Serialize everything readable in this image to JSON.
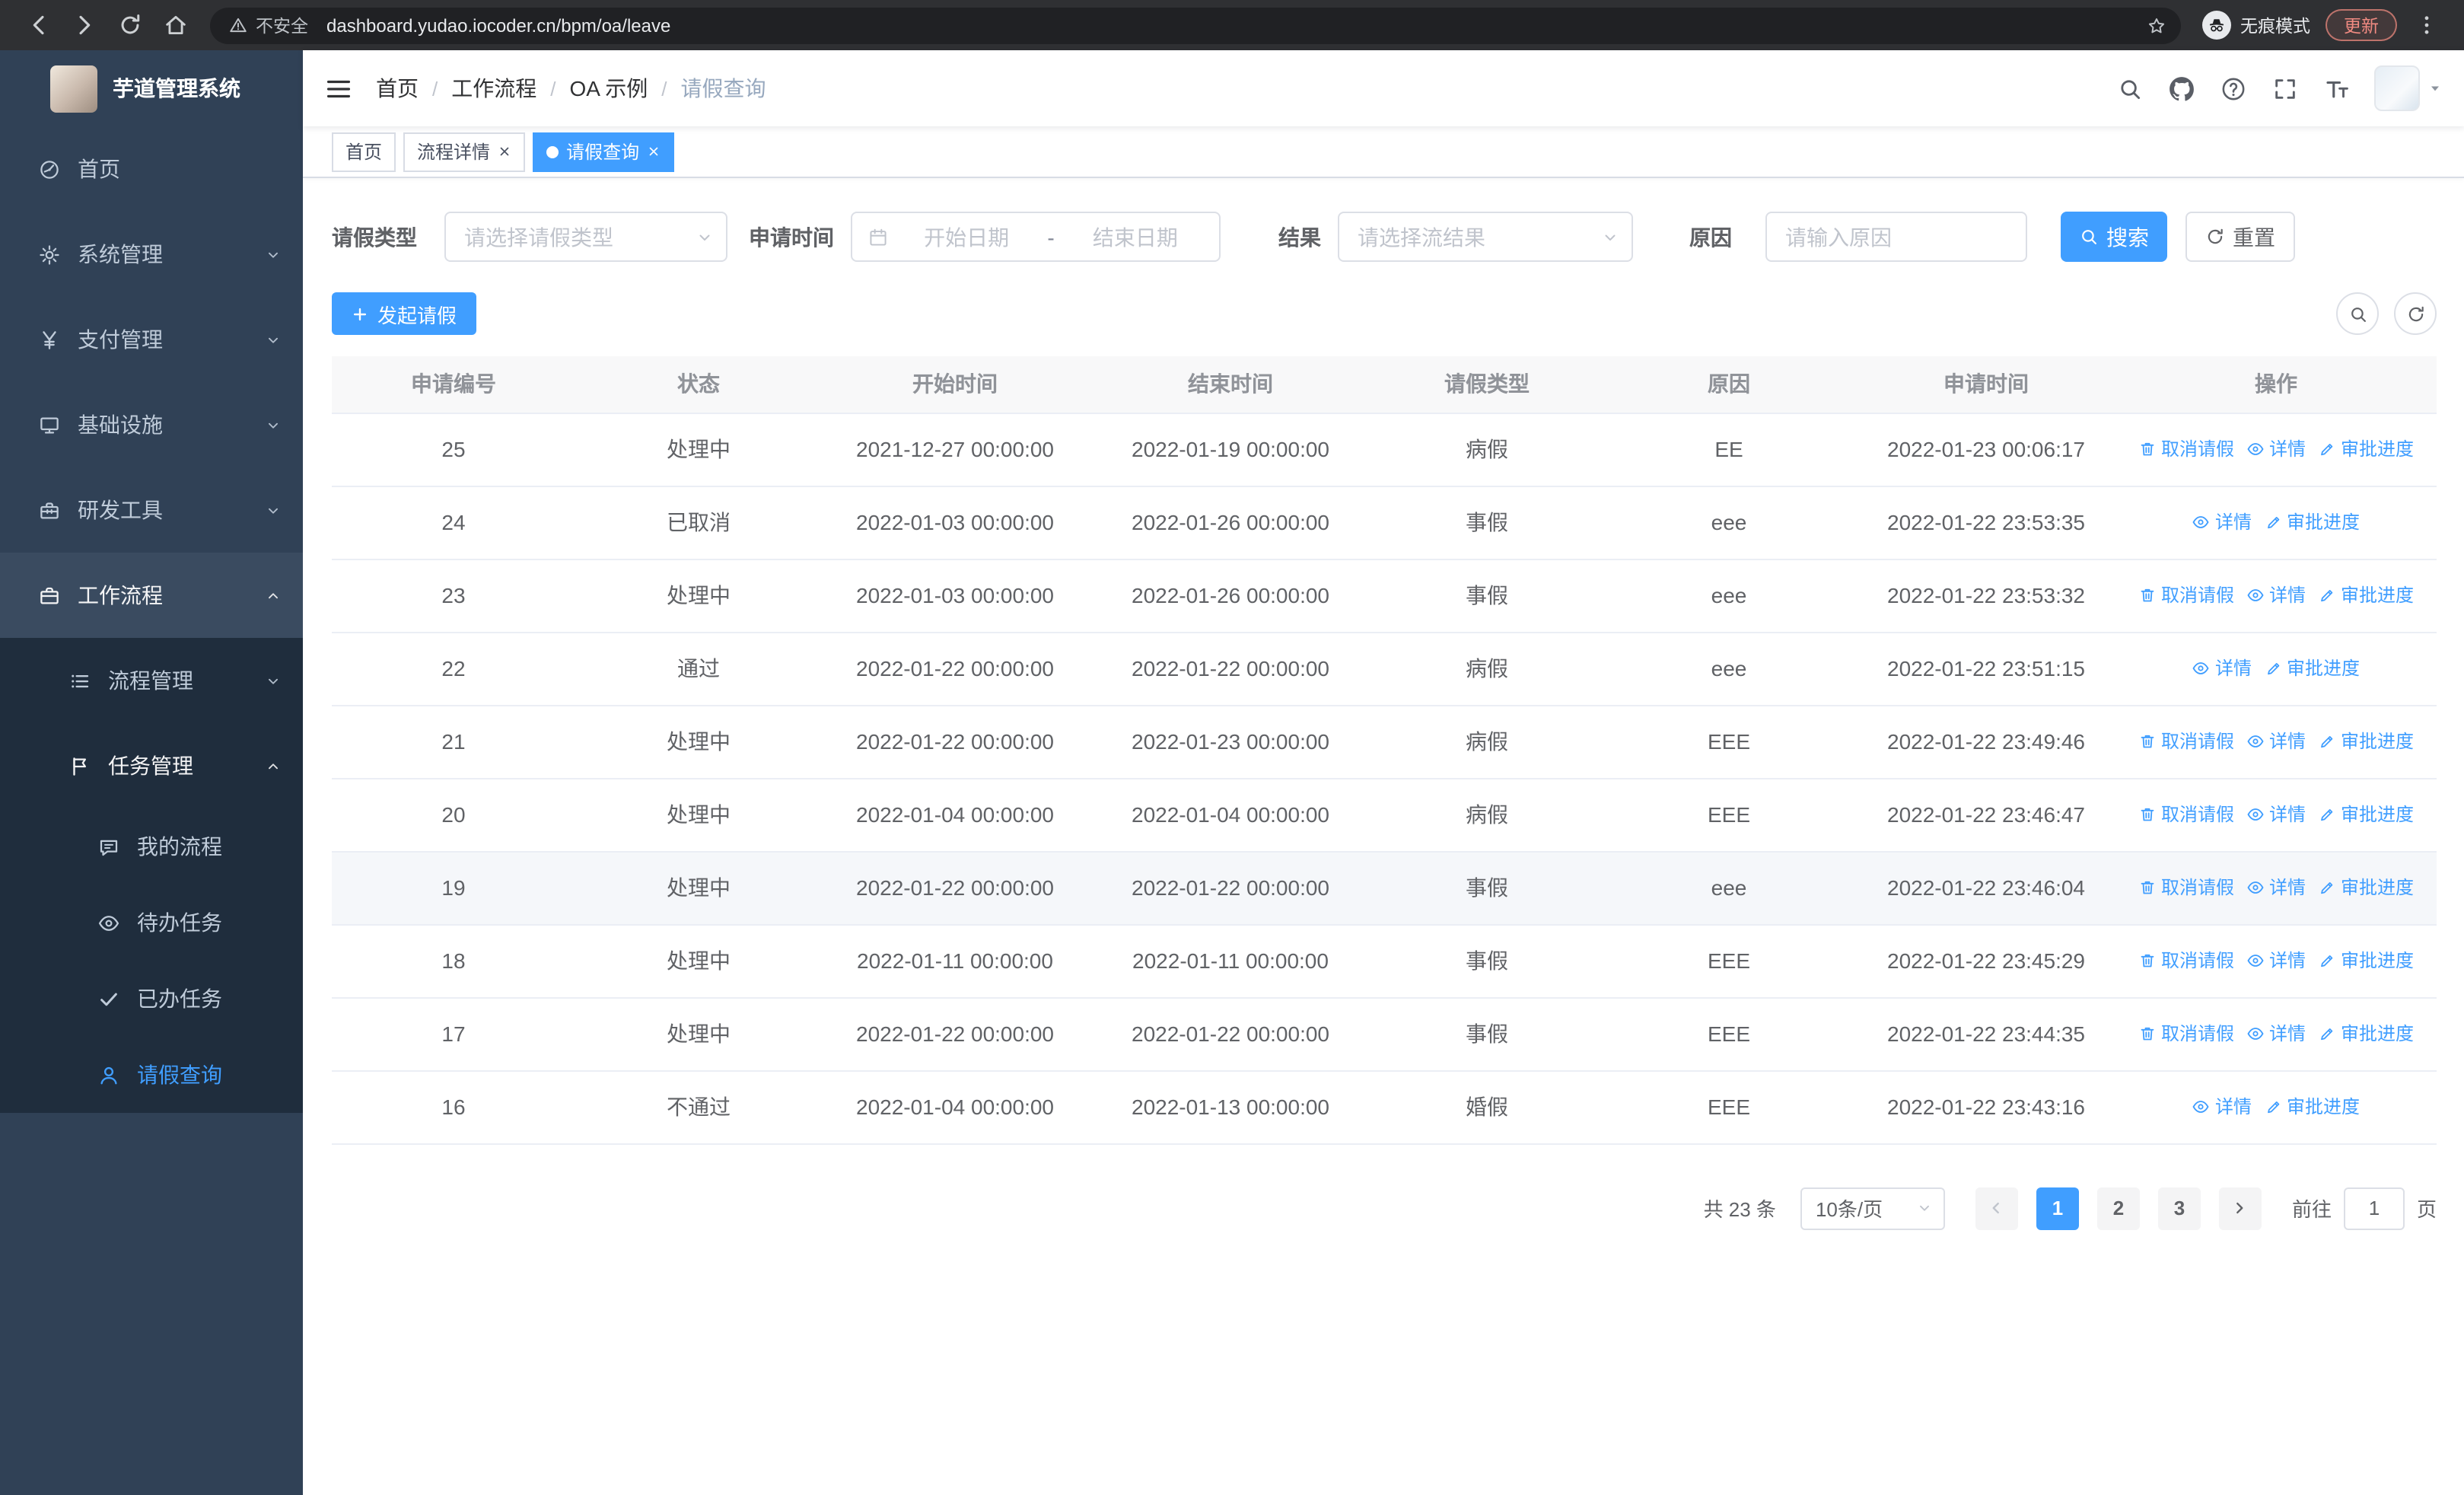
{
  "theme": {
    "primary": "#409eff",
    "sidebar_bg": "#304156",
    "sidebar_submenu_bg": "#1f2d3d",
    "tag_active_bg": "#409eff",
    "update_pill": "#f28b82"
  },
  "browser": {
    "security_label": "不安全",
    "url": "dashboard.yudao.iocoder.cn/bpm/oa/leave",
    "incognito_label": "无痕模式",
    "update_label": "更新"
  },
  "sidebar": {
    "logo_title": "芋道管理系统",
    "items": [
      {
        "name": "sidebar-item-home",
        "icon": "dashboard-icon",
        "label": "首页",
        "level": 1
      },
      {
        "name": "sidebar-item-system",
        "icon": "gear-icon",
        "label": "系统管理",
        "level": 1,
        "arrow": "down"
      },
      {
        "name": "sidebar-item-payment",
        "icon": "yen-icon",
        "label": "支付管理",
        "level": 1,
        "arrow": "down"
      },
      {
        "name": "sidebar-item-infrastructure",
        "icon": "monitor-icon",
        "label": "基础设施",
        "level": 1,
        "arrow": "down"
      },
      {
        "name": "sidebar-item-devtools",
        "icon": "toolbox-icon",
        "label": "研发工具",
        "level": 1,
        "arrow": "down"
      },
      {
        "name": "sidebar-item-workflow",
        "icon": "briefcase-icon",
        "label": "工作流程",
        "level": 1,
        "arrow": "up",
        "open": true
      },
      {
        "name": "sidebar-item-process-mgmt",
        "icon": "list-icon",
        "label": "流程管理",
        "level": 2,
        "arrow": "down"
      },
      {
        "name": "sidebar-item-task-mgmt",
        "icon": "flag-icon",
        "label": "任务管理",
        "level": 2,
        "arrow": "up",
        "open": true
      },
      {
        "name": "sidebar-item-my-process",
        "icon": "chat-icon",
        "label": "我的流程",
        "level": 3
      },
      {
        "name": "sidebar-item-todo-tasks",
        "icon": "eye-icon",
        "label": "待办任务",
        "level": 3
      },
      {
        "name": "sidebar-item-done-tasks",
        "icon": "check-icon",
        "label": "已办任务",
        "level": 3
      },
      {
        "name": "sidebar-item-leave-query",
        "icon": "user-icon",
        "label": "请假查询",
        "level": 3,
        "active": true
      }
    ]
  },
  "header": {
    "breadcrumbs": [
      "首页",
      "工作流程",
      "OA 示例",
      "请假查询"
    ],
    "separator": "/"
  },
  "tabs": [
    {
      "label": "首页"
    },
    {
      "label": "流程详情",
      "closable": true
    },
    {
      "label": "请假查询",
      "closable": true,
      "active": true
    }
  ],
  "filters": {
    "leave_type_label": "请假类型",
    "leave_type_placeholder": "请选择请假类型",
    "apply_time_label": "申请时间",
    "start_placeholder": "开始日期",
    "range_separator": "-",
    "end_placeholder": "结束日期",
    "result_label": "结果",
    "result_placeholder": "请选择流结果",
    "reason_label": "原因",
    "reason_placeholder": "请输入原因",
    "search_label": "搜索",
    "reset_label": "重置"
  },
  "toolbar": {
    "create_label": "发起请假"
  },
  "table": {
    "columns": [
      "申请编号",
      "状态",
      "开始时间",
      "结束时间",
      "请假类型",
      "原因",
      "申请时间",
      "操作"
    ],
    "action_labels": {
      "cancel": "取消请假",
      "detail": "详情",
      "progress": "审批进度"
    },
    "rows": [
      {
        "id": "25",
        "status": "处理中",
        "start": "2021-12-27 00:00:00",
        "end": "2022-01-19 00:00:00",
        "type": "病假",
        "reason": "EE",
        "apply": "2022-01-23 00:06:17",
        "cancelable": true,
        "hover": false
      },
      {
        "id": "24",
        "status": "已取消",
        "start": "2022-01-03 00:00:00",
        "end": "2022-01-26 00:00:00",
        "type": "事假",
        "reason": "eee",
        "apply": "2022-01-22 23:53:35",
        "cancelable": false,
        "hover": false
      },
      {
        "id": "23",
        "status": "处理中",
        "start": "2022-01-03 00:00:00",
        "end": "2022-01-26 00:00:00",
        "type": "事假",
        "reason": "eee",
        "apply": "2022-01-22 23:53:32",
        "cancelable": true,
        "hover": false
      },
      {
        "id": "22",
        "status": "通过",
        "start": "2022-01-22 00:00:00",
        "end": "2022-01-22 00:00:00",
        "type": "病假",
        "reason": "eee",
        "apply": "2022-01-22 23:51:15",
        "cancelable": false,
        "hover": false
      },
      {
        "id": "21",
        "status": "处理中",
        "start": "2022-01-22 00:00:00",
        "end": "2022-01-23 00:00:00",
        "type": "病假",
        "reason": "EEE",
        "apply": "2022-01-22 23:49:46",
        "cancelable": true,
        "hover": false
      },
      {
        "id": "20",
        "status": "处理中",
        "start": "2022-01-04 00:00:00",
        "end": "2022-01-04 00:00:00",
        "type": "病假",
        "reason": "EEE",
        "apply": "2022-01-22 23:46:47",
        "cancelable": true,
        "hover": false
      },
      {
        "id": "19",
        "status": "处理中",
        "start": "2022-01-22 00:00:00",
        "end": "2022-01-22 00:00:00",
        "type": "事假",
        "reason": "eee",
        "apply": "2022-01-22 23:46:04",
        "cancelable": true,
        "hover": true
      },
      {
        "id": "18",
        "status": "处理中",
        "start": "2022-01-11 00:00:00",
        "end": "2022-01-11 00:00:00",
        "type": "事假",
        "reason": "EEE",
        "apply": "2022-01-22 23:45:29",
        "cancelable": true,
        "hover": false
      },
      {
        "id": "17",
        "status": "处理中",
        "start": "2022-01-22 00:00:00",
        "end": "2022-01-22 00:00:00",
        "type": "事假",
        "reason": "EEE",
        "apply": "2022-01-22 23:44:35",
        "cancelable": true,
        "hover": false
      },
      {
        "id": "16",
        "status": "不通过",
        "start": "2022-01-04 00:00:00",
        "end": "2022-01-13 00:00:00",
        "type": "婚假",
        "reason": "EEE",
        "apply": "2022-01-22 23:43:16",
        "cancelable": false,
        "hover": false
      }
    ]
  },
  "pagination": {
    "total_label": "共 23 条",
    "page_size_label": "10条/页",
    "pages": [
      "1",
      "2",
      "3"
    ],
    "active_page": "1",
    "goto_label": "前往",
    "goto_value": "1",
    "page_unit": "页"
  }
}
